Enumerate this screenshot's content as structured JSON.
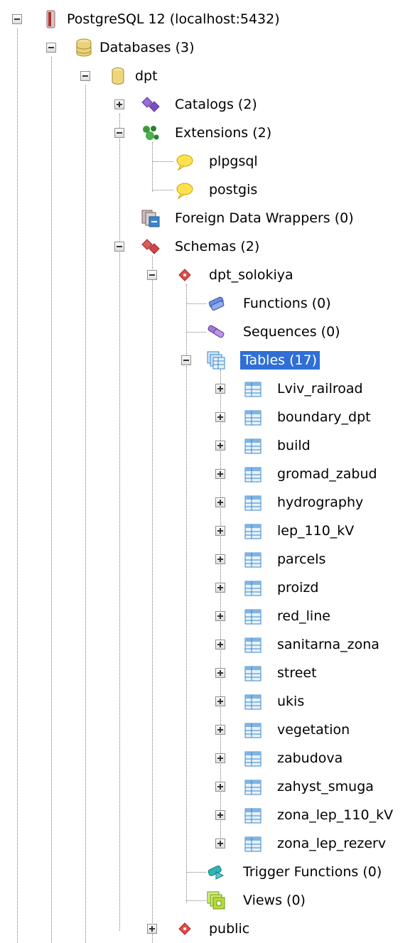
{
  "tree": {
    "server": "PostgreSQL 12 (localhost:5432)",
    "databases": "Databases (3)",
    "database": "dpt",
    "catalogs": "Catalogs (2)",
    "extensions": "Extensions (2)",
    "extension_items": [
      "plpgsql",
      "postgis"
    ],
    "fdw": "Foreign Data Wrappers (0)",
    "schemas": "Schemas (2)",
    "schema": "dpt_solokiya",
    "functions": "Functions (0)",
    "sequences": "Sequences (0)",
    "tables": "Tables (17)",
    "table_items": [
      "Lviv_railroad",
      "boundary_dpt",
      "build",
      "gromad_zabud",
      "hydrography",
      "lep_110_kV",
      "parcels",
      "proizd",
      "red_line",
      "sanitarna_zona",
      "street",
      "ukis",
      "vegetation",
      "zabudova",
      "zahyst_smuga",
      "zona_lep_110_kV",
      "zona_lep_rezerv"
    ],
    "trigger_functions": "Trigger Functions (0)",
    "views": "Views (0)",
    "public_schema": "public",
    "selected_color": "#2f6fd6"
  }
}
